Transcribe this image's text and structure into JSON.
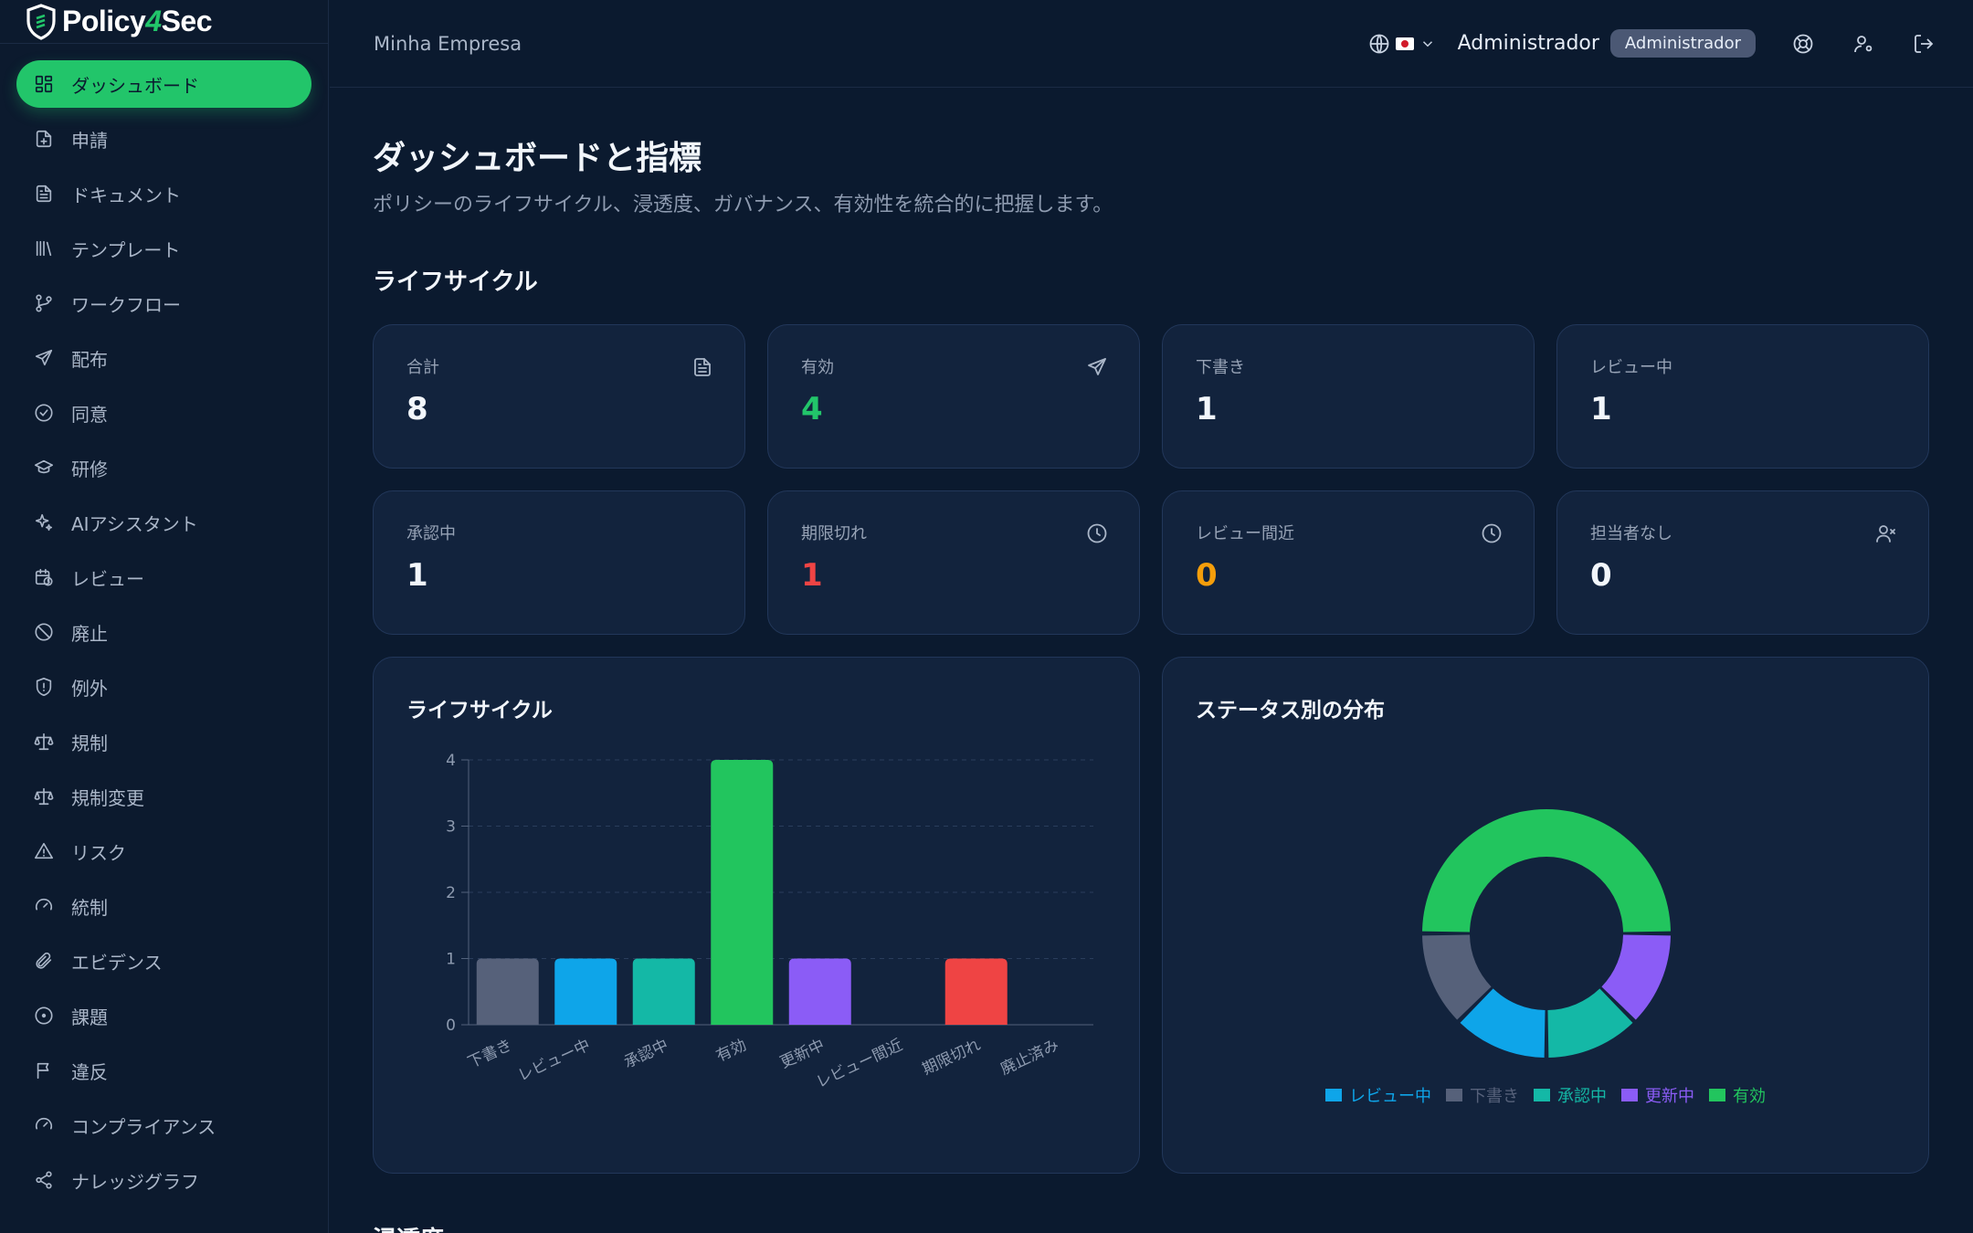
{
  "brand": {
    "name_a": "Policy",
    "name_four": "4",
    "name_b": "Sec"
  },
  "sidebar": {
    "items": [
      {
        "label": "ダッシュボード",
        "icon": "dashboard-icon",
        "active": true
      },
      {
        "label": "申請",
        "icon": "file-plus-icon"
      },
      {
        "label": "ドキュメント",
        "icon": "document-icon"
      },
      {
        "label": "テンプレート",
        "icon": "library-icon"
      },
      {
        "label": "ワークフロー",
        "icon": "git-branch-icon"
      },
      {
        "label": "配布",
        "icon": "send-icon"
      },
      {
        "label": "同意",
        "icon": "check-circle-icon"
      },
      {
        "label": "研修",
        "icon": "graduation-cap-icon"
      },
      {
        "label": "AIアシスタント",
        "icon": "sparkles-icon"
      },
      {
        "label": "レビュー",
        "icon": "calendar-clock-icon"
      },
      {
        "label": "廃止",
        "icon": "ban-icon"
      },
      {
        "label": "例外",
        "icon": "shield-alert-icon"
      },
      {
        "label": "規制",
        "icon": "scale-icon"
      },
      {
        "label": "規制変更",
        "icon": "scale-icon"
      },
      {
        "label": "リスク",
        "icon": "warning-icon"
      },
      {
        "label": "統制",
        "icon": "gauge-icon"
      },
      {
        "label": "エビデンス",
        "icon": "paperclip-icon"
      },
      {
        "label": "課題",
        "icon": "dot-circle-icon"
      },
      {
        "label": "違反",
        "icon": "flag-icon"
      },
      {
        "label": "コンプライアンス",
        "icon": "gauge-icon"
      },
      {
        "label": "ナレッジグラフ",
        "icon": "share-icon"
      }
    ]
  },
  "header": {
    "company": "Minha Empresa",
    "user_name": "Administrador",
    "role": "Administrador"
  },
  "page": {
    "title": "ダッシュボードと指標",
    "subtitle": "ポリシーのライフサイクル、浸透度、ガバナンス、有効性を統合的に把握します。",
    "section_lifecycle": "ライフサイクル",
    "section_next": "浸透度"
  },
  "cards": [
    {
      "label": "合計",
      "value": "8",
      "tone": "default",
      "icon": "document-icon"
    },
    {
      "label": "有効",
      "value": "4",
      "tone": "green",
      "icon": "send-icon"
    },
    {
      "label": "下書き",
      "value": "1",
      "tone": "default",
      "icon": ""
    },
    {
      "label": "レビュー中",
      "value": "1",
      "tone": "default",
      "icon": ""
    },
    {
      "label": "承認中",
      "value": "1",
      "tone": "default",
      "icon": ""
    },
    {
      "label": "期限切れ",
      "value": "1",
      "tone": "red",
      "icon": "clock-icon"
    },
    {
      "label": "レビュー間近",
      "value": "0",
      "tone": "amber",
      "icon": "clock-icon"
    },
    {
      "label": "担当者なし",
      "value": "0",
      "tone": "default",
      "icon": "user-x-icon"
    }
  ],
  "colors": {
    "accent": "#22c56a",
    "red": "#ef4444",
    "amber": "#f59e0b"
  },
  "chart_data": [
    {
      "type": "bar",
      "title": "ライフサイクル",
      "categories": [
        "下書き",
        "レビュー中",
        "承認中",
        "有効",
        "更新中",
        "レビュー間近",
        "期限切れ",
        "廃止済み"
      ],
      "values": [
        1,
        1,
        1,
        4,
        1,
        0,
        1,
        0
      ],
      "colors": [
        "#56617a",
        "#0ea5e9",
        "#14b8a6",
        "#22c55e",
        "#8b5cf6",
        "#f59e0b",
        "#ef4444",
        "#64748b"
      ],
      "ylim": [
        0,
        4
      ],
      "yticks": [
        "0",
        "1",
        "2",
        "3",
        "4"
      ],
      "grid": true
    },
    {
      "type": "pie",
      "title": "ステータス別の分布",
      "labels": [
        "有効",
        "下書き",
        "レビュー中",
        "承認中",
        "更新中"
      ],
      "values": [
        4,
        1,
        1,
        1,
        1
      ],
      "colors": [
        "#22c55e",
        "#56617a",
        "#0ea5e9",
        "#14b8a6",
        "#8b5cf6"
      ],
      "legend": [
        {
          "label": "レビュー中",
          "color": "#0ea5e9"
        },
        {
          "label": "下書き",
          "color": "#56617a"
        },
        {
          "label": "承認中",
          "color": "#14b8a6"
        },
        {
          "label": "更新中",
          "color": "#8b5cf6"
        },
        {
          "label": "有効",
          "color": "#22c55e"
        }
      ],
      "legend_position": "bottom"
    }
  ]
}
